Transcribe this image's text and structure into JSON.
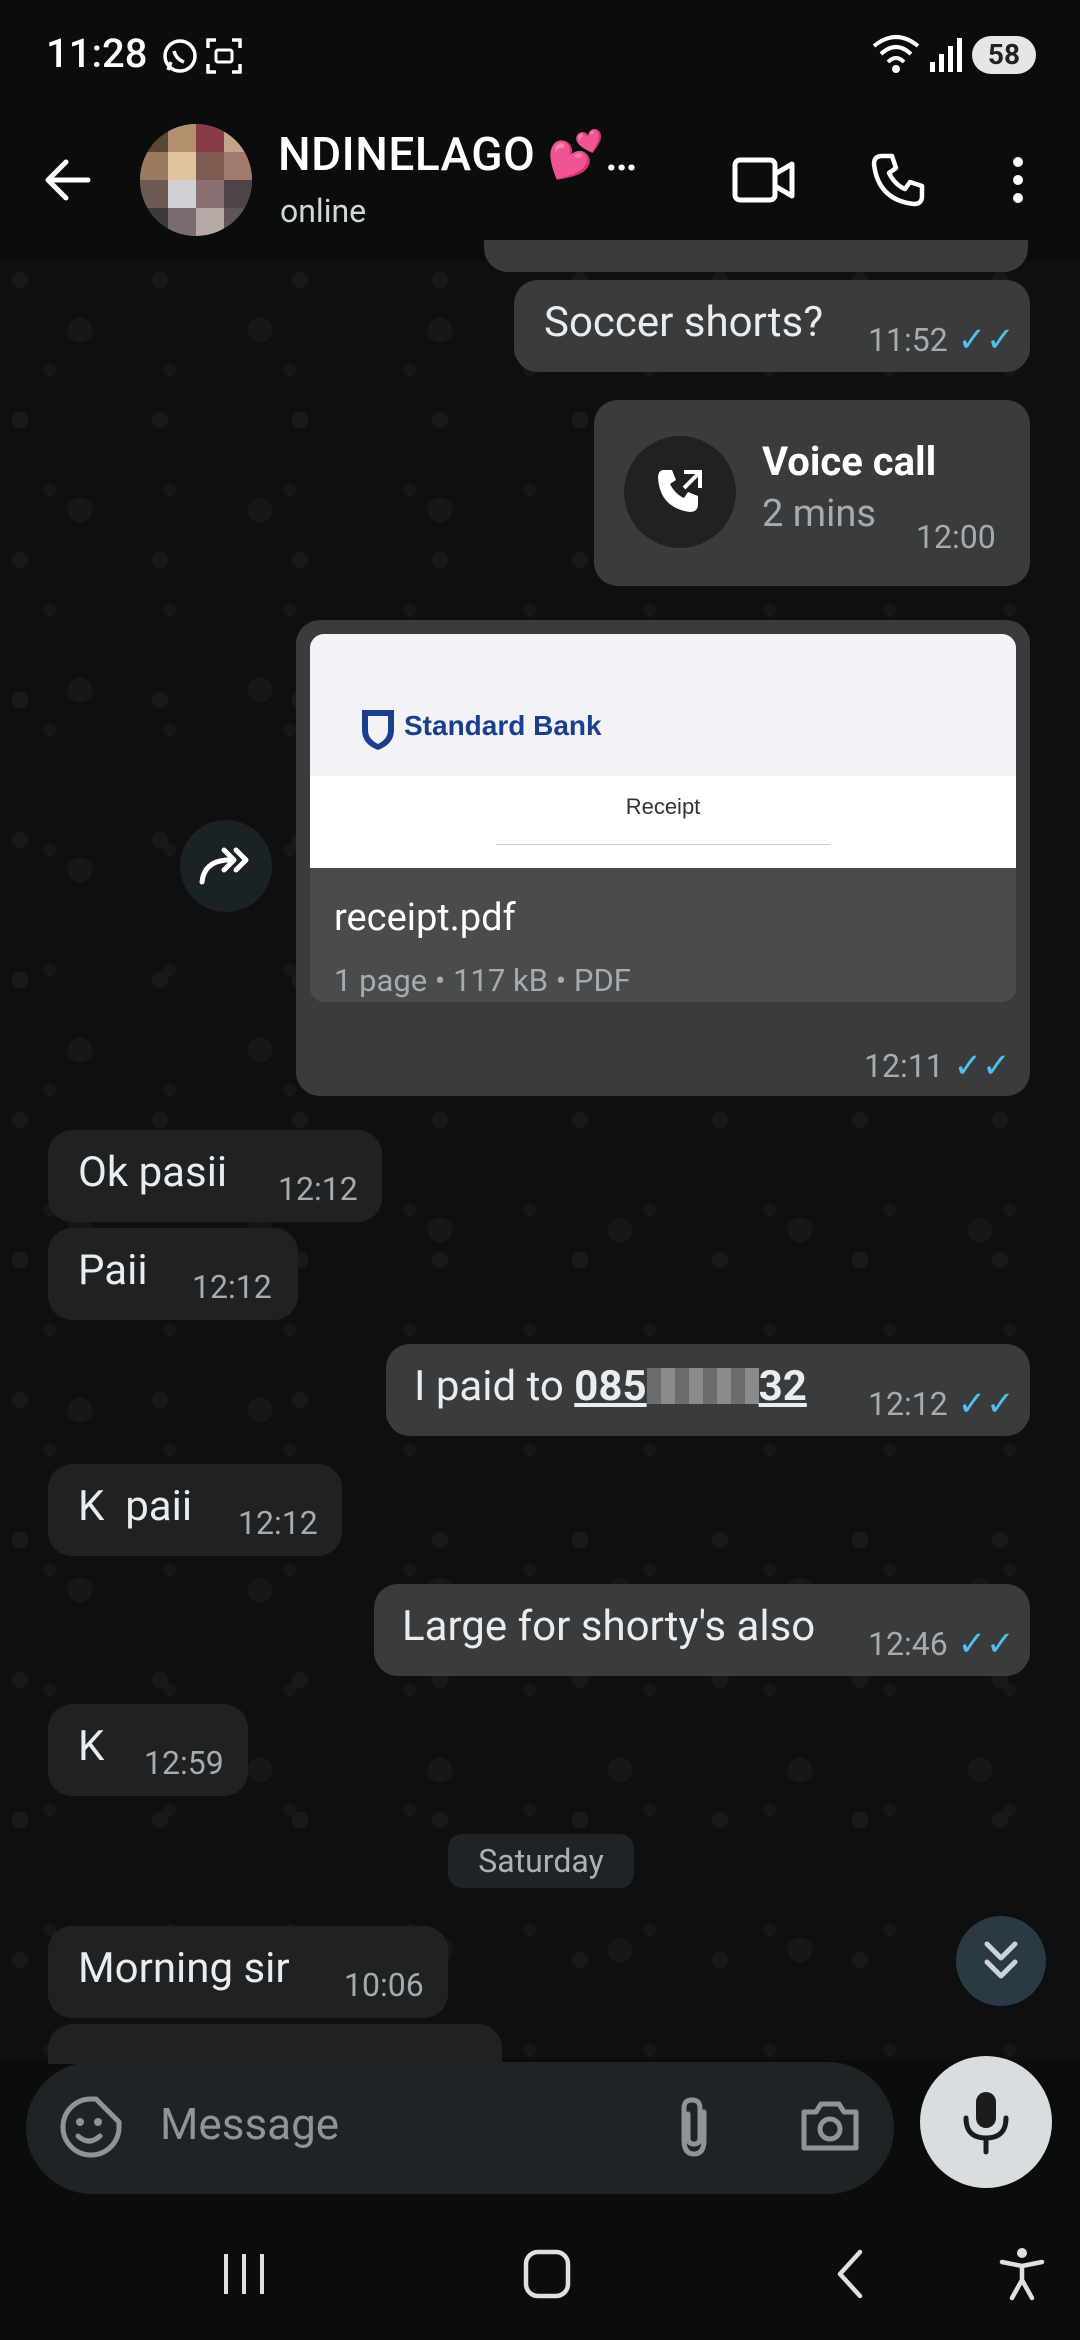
{
  "status_bar": {
    "time": "11:28",
    "battery": "58"
  },
  "header": {
    "contact_name": "NDINELAGO 💕…",
    "status": "online"
  },
  "messages": {
    "soccer": {
      "text": "Soccer shorts?",
      "time": "11:52"
    },
    "voice_call": {
      "title": "Voice call",
      "duration": "2 mins",
      "time": "12:00"
    },
    "document": {
      "brand": "Standard Bank",
      "preview_title": "Receipt",
      "file_name": "receipt.pdf",
      "file_meta": "1 page • 117 kB • PDF",
      "time": "12:11"
    },
    "ok_pasii": {
      "text": "Ok pasii",
      "time": "12:12"
    },
    "paii": {
      "text": "Paii",
      "time": "12:12"
    },
    "paid_to": {
      "prefix": "I paid to ",
      "number_start": "085",
      "number_end": "32",
      "time": "12:12"
    },
    "k_paii": {
      "text": "K  paii",
      "time": "12:12"
    },
    "large": {
      "text": "Large for shorty's also",
      "time": "12:46"
    },
    "k": {
      "text": "K",
      "time": "12:59"
    },
    "morning": {
      "text": "Morning sir",
      "time": "10:06"
    }
  },
  "day_separator": "Saturday",
  "composer": {
    "placeholder": "Message"
  },
  "colors": {
    "tick_blue": "#53bdeb",
    "outgoing_bubble": "#3a3b3c",
    "incoming_bubble": "#1f2122"
  }
}
